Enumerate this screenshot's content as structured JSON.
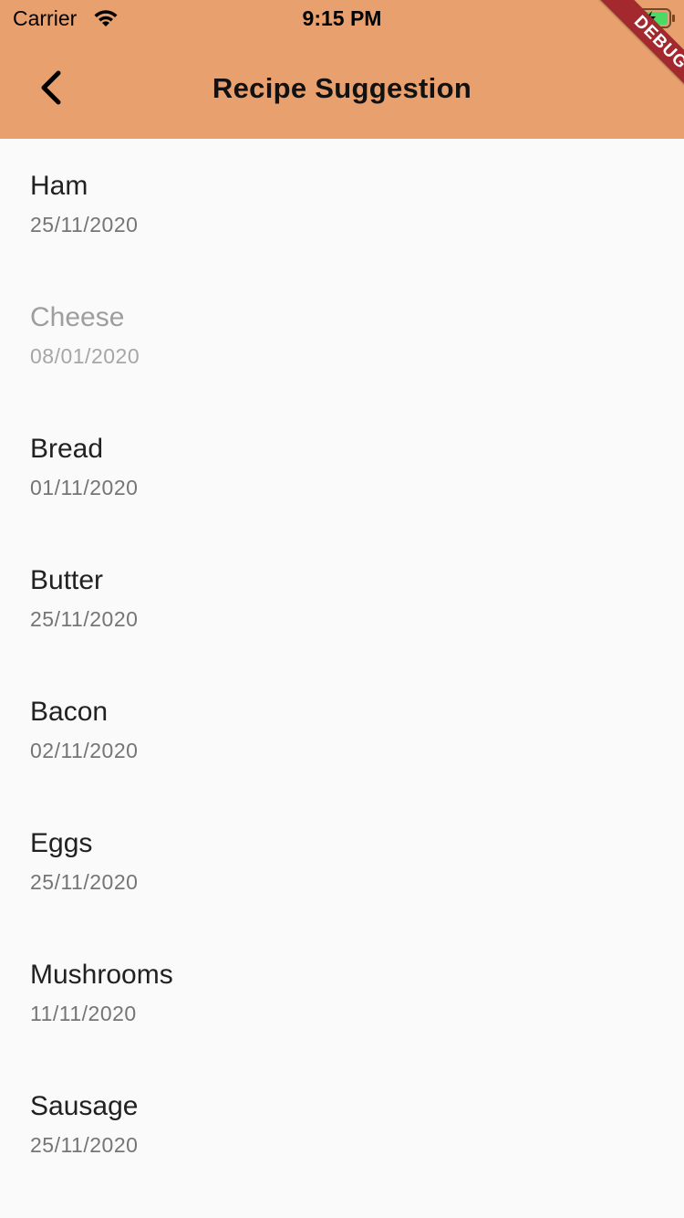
{
  "status_bar": {
    "carrier": "Carrier",
    "time": "9:15 PM"
  },
  "app_bar": {
    "title": "Recipe Suggestion",
    "background_color": "#e8a06e",
    "back_icon": "chevron-left-icon"
  },
  "debug_banner": {
    "label": "DEBUG",
    "color": "#a3292e"
  },
  "items": [
    {
      "name": "Ham",
      "date": "25/11/2020",
      "disabled": false
    },
    {
      "name": "Cheese",
      "date": "08/01/2020",
      "disabled": true
    },
    {
      "name": "Bread",
      "date": "01/11/2020",
      "disabled": false
    },
    {
      "name": "Butter",
      "date": "25/11/2020",
      "disabled": false
    },
    {
      "name": "Bacon",
      "date": "02/11/2020",
      "disabled": false
    },
    {
      "name": "Eggs",
      "date": "25/11/2020",
      "disabled": false
    },
    {
      "name": "Mushrooms",
      "date": "11/11/2020",
      "disabled": false
    },
    {
      "name": "Sausage",
      "date": "25/11/2020",
      "disabled": false
    }
  ]
}
